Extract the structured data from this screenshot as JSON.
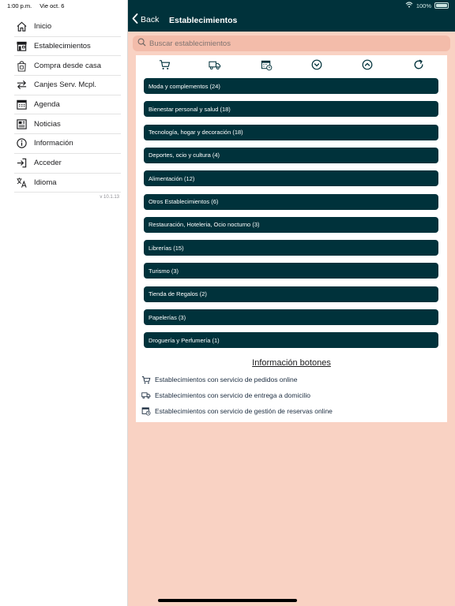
{
  "status_bar": {
    "time": "1:00 p.m.",
    "date": "Vie oct. 6",
    "battery": "100%"
  },
  "sidebar": {
    "items": [
      {
        "label": "Inicio",
        "icon": "home-icon"
      },
      {
        "label": "Establecimientos",
        "icon": "storefront-icon"
      },
      {
        "label": "Compra desde casa",
        "icon": "shopping-bag-icon"
      },
      {
        "label": "Canjes Serv. Mcpl.",
        "icon": "exchange-arrows-icon"
      },
      {
        "label": "Agenda",
        "icon": "calendar-icon"
      },
      {
        "label": "Noticias",
        "icon": "newspaper-icon"
      },
      {
        "label": "Información",
        "icon": "info-icon"
      },
      {
        "label": "Acceder",
        "icon": "login-icon"
      },
      {
        "label": "Idioma",
        "icon": "translate-icon"
      }
    ],
    "version": "v 10.1.13"
  },
  "navbar": {
    "back_label": "Back",
    "title": "Establecimientos"
  },
  "search": {
    "placeholder": "Buscar establecimientos"
  },
  "toolbar": {
    "icons": [
      "cart-icon",
      "delivery-truck-icon",
      "calendar-clock-icon",
      "chevron-down-circle-icon",
      "chevron-up-circle-icon",
      "refresh-icon"
    ]
  },
  "categories": [
    "Moda y complementos (24)",
    "Bienestar personal y salud (18)",
    "Tecnología, hogar y decoración (18)",
    "Deportes, ocio y cultura (4)",
    "Alimentación (12)",
    "Otros Establecimientos (6)",
    "Restauración, Hoteleria, Ocio nocturno (3)",
    "Librerías (15)",
    "Turismo (3)",
    "Tienda de Regalos (2)",
    "Papelerías (3)",
    "Droguería y Perfumería (1)"
  ],
  "info": {
    "title": "Información botones",
    "legend": [
      {
        "icon": "cart-icon",
        "text": "Establecimientos con servicio de pedidos online"
      },
      {
        "icon": "delivery-truck-icon",
        "text": "Establecimientos con servicio de entrega a domicilio"
      },
      {
        "icon": "calendar-clock-icon",
        "text": "Establecimientos con servicio de gestión de reservas online"
      }
    ]
  },
  "colors": {
    "nav_bg": "#00323b",
    "page_bg": "#f9d2c3",
    "search_bg": "#f3bcaa",
    "category_bg": "#00323b"
  }
}
